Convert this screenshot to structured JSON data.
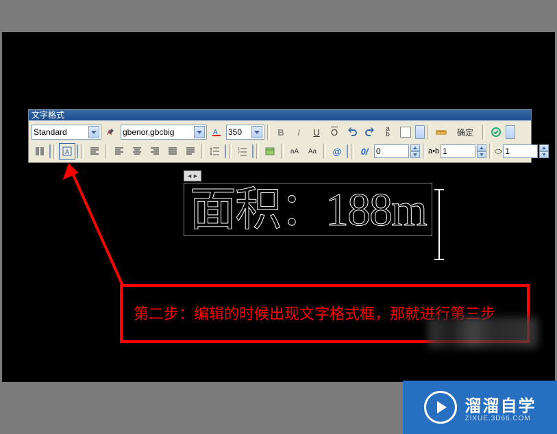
{
  "panel": {
    "title": "文字格式",
    "style_name": "Standard",
    "font_name": "gbenor,gbcbig",
    "text_height": "350",
    "ok_label": "确定",
    "spin_a": "0",
    "spin_b": "1",
    "spin_c": "1"
  },
  "cad": {
    "text": "面积：188m"
  },
  "annotation": {
    "text": "第二步：编辑的时候出现文字格式框，那就进行第三步"
  },
  "logo": {
    "brand": "溜溜自学",
    "sub": "ZIXUE.3D66.COM"
  }
}
